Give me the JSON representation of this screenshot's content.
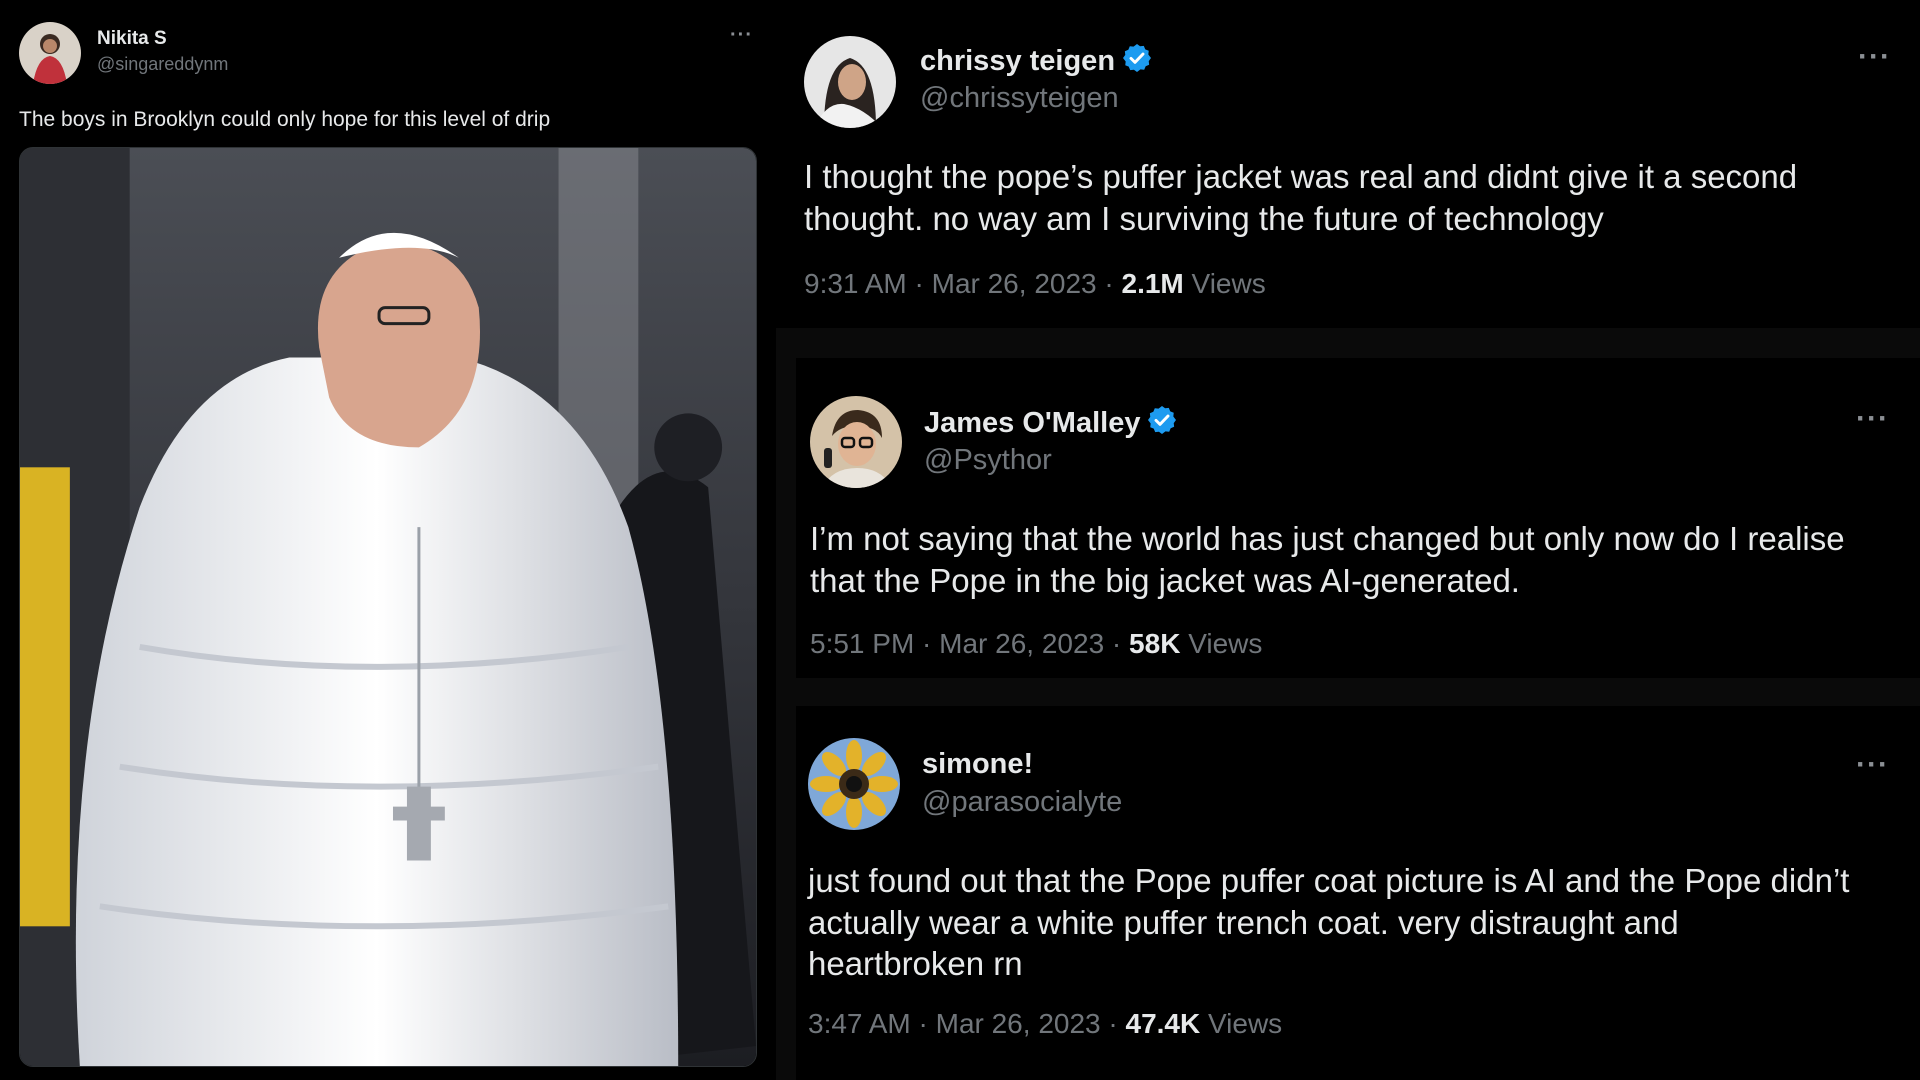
{
  "left_tweet": {
    "name": "Nikita S",
    "handle": "@singareddynm",
    "more": "···",
    "text": "The boys in Brooklyn could only hope for this level of drip",
    "media_alt_icon": "photo-pope-white-puffer-coat"
  },
  "right_tweets": [
    {
      "name": "chrissy teigen",
      "verified": true,
      "handle": "@chrissyteigen",
      "more": "···",
      "text_line1": "I thought the pope’s puffer jacket was real and didnt give it a second",
      "text_line2": "thought. no way am I surviving the future of technology",
      "time": "9:31 AM · Mar 26, 2023 · ",
      "views_count": "2.1M",
      "views_label": " Views"
    },
    {
      "name": "James O'Malley",
      "verified": true,
      "handle": "@Psythor",
      "more": "···",
      "text_line1": "I’m not saying that the world has just changed but only now do I realise",
      "text_line2": "that the Pope in the big jacket was AI-generated.",
      "time": "5:51 PM · Mar 26, 2023 · ",
      "views_count": "58K",
      "views_label": " Views"
    },
    {
      "name": "simone!",
      "verified": false,
      "handle": "@parasocialyte",
      "more": "···",
      "text_line1": "just found out that the Pope puffer coat picture is AI and the Pope didn’t",
      "text_line2": "actually wear a white puffer trench coat. very distraught and",
      "text_line3": "heartbroken rn",
      "time": "3:47 AM · Mar 26, 2023 · ",
      "views_count": "47.4K",
      "views_label": " Views"
    }
  ],
  "colors": {
    "background": "#000000",
    "text": "#e7e9ea",
    "secondary": "#71767b",
    "verified": "#1d9bf0"
  }
}
